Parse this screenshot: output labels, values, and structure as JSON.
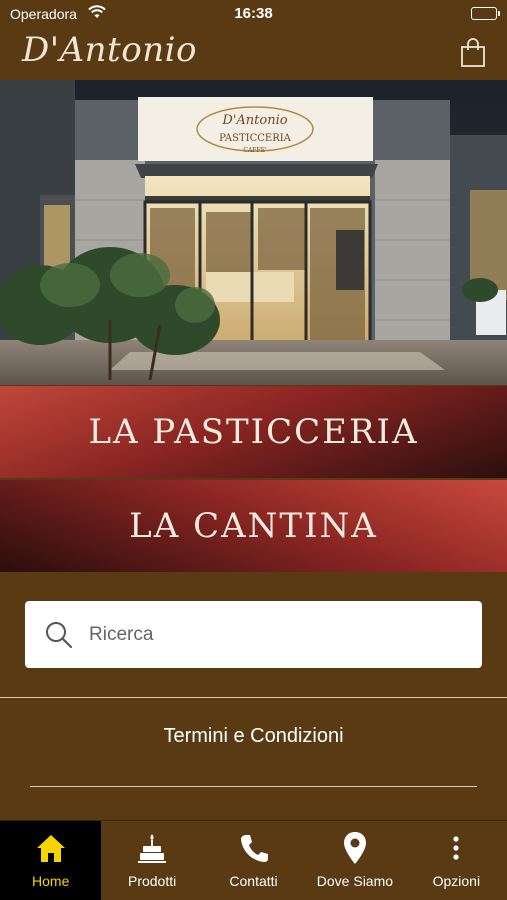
{
  "status_bar": {
    "carrier": "Operadora",
    "time": "16:38"
  },
  "header": {
    "logo_text": "D'Antonio",
    "cart_icon": "shopping-bag-icon"
  },
  "hero": {
    "sign_brand": "D'Antonio",
    "sign_line_1": "PASTICCERIA",
    "sign_line_2": "CAFFE'"
  },
  "categories": [
    {
      "label": "LA PASTICCERIA"
    },
    {
      "label": "LA CANTINA"
    }
  ],
  "search": {
    "placeholder": "Ricerca",
    "value": ""
  },
  "links": {
    "terms": "Termini e Condizioni"
  },
  "tab_bar": {
    "tabs": [
      {
        "label": "Home",
        "icon": "home-icon",
        "active": true
      },
      {
        "label": "Prodotti",
        "icon": "cake-icon",
        "active": false
      },
      {
        "label": "Contatti",
        "icon": "phone-icon",
        "active": false
      },
      {
        "label": "Dove Siamo",
        "icon": "map-pin-icon",
        "active": false
      },
      {
        "label": "Opzioni",
        "icon": "more-vertical-icon",
        "active": false
      }
    ]
  },
  "colors": {
    "background": "#5a3a12",
    "active_tab_bg": "#000000",
    "active_tab_fg": "#f5d400",
    "banner_red": "#a8332c"
  }
}
